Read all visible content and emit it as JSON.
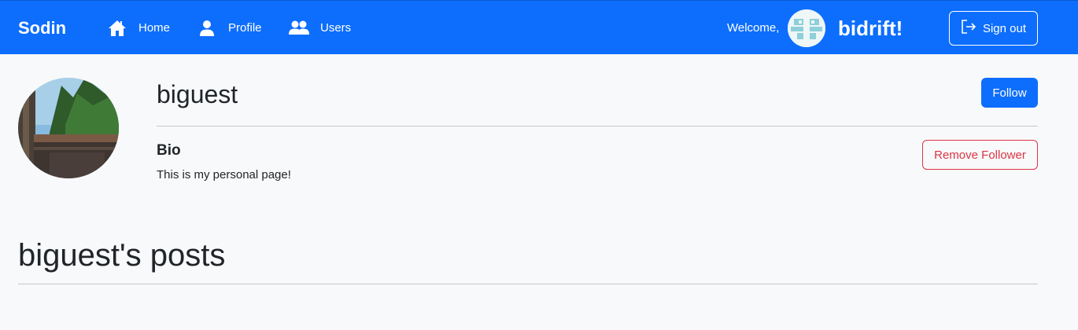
{
  "navbar": {
    "brand": "Sodin",
    "links": [
      {
        "label": "Home",
        "icon": "house-icon"
      },
      {
        "label": "Profile",
        "icon": "person-icon"
      },
      {
        "label": "Users",
        "icon": "people-icon"
      }
    ],
    "welcome": "Welcome,",
    "username": "bidrift!",
    "sign_out_label": "Sign out",
    "color": "#0d6efd"
  },
  "profile": {
    "name": "biguest",
    "follow_label": "Follow",
    "bio_heading": "Bio",
    "bio_text": "This is my personal page!",
    "remove_follower_label": "Remove Follower"
  },
  "posts": {
    "heading": "biguest's posts"
  },
  "colors": {
    "primary": "#0d6efd",
    "danger": "#dc3545",
    "background": "#f8f9fa"
  }
}
